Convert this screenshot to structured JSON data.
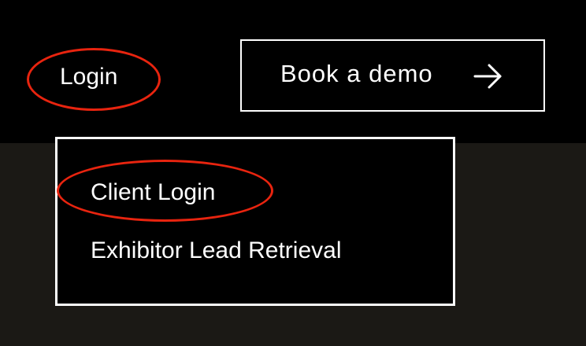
{
  "header": {
    "login_label": "Login",
    "demo_button": {
      "label": "Book a demo",
      "icon": "arrow-right-icon"
    }
  },
  "login_menu": {
    "items": [
      {
        "label": "Client Login"
      },
      {
        "label": "Exhibitor Lead Retrieval"
      }
    ]
  },
  "colors": {
    "header_background": "#000000",
    "page_background": "#1b1915",
    "text": "#ffffff",
    "annotation": "#e8240f"
  }
}
